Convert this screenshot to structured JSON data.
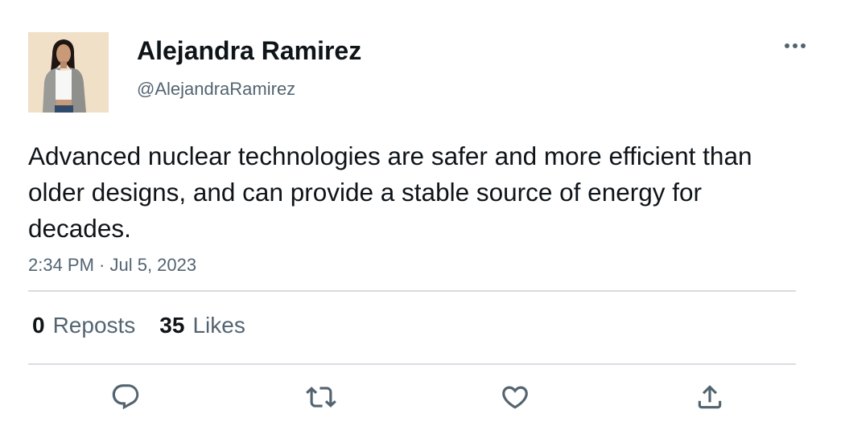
{
  "author": {
    "display_name": "Alejandra Ramirez",
    "handle": "@AlejandraRamirez",
    "avatar_icon": "profile-photo"
  },
  "tweet": {
    "text": "Advanced nuclear technologies are safer and more efficient than older designs, and can provide a stable source of energy for decades.",
    "timestamp": "2:34 PM · Jul 5, 2023"
  },
  "stats": {
    "reposts_count": "0",
    "reposts_label": "Reposts",
    "likes_count": "35",
    "likes_label": "Likes"
  },
  "actions": {
    "reply_icon": "reply-icon",
    "repost_icon": "repost-icon",
    "like_icon": "heart-icon",
    "share_icon": "share-icon",
    "more_icon": "more-options-icon"
  },
  "colors": {
    "text_primary": "#0f1419",
    "text_secondary": "#536471",
    "divider": "#d9dde1",
    "background": "#ffffff"
  }
}
